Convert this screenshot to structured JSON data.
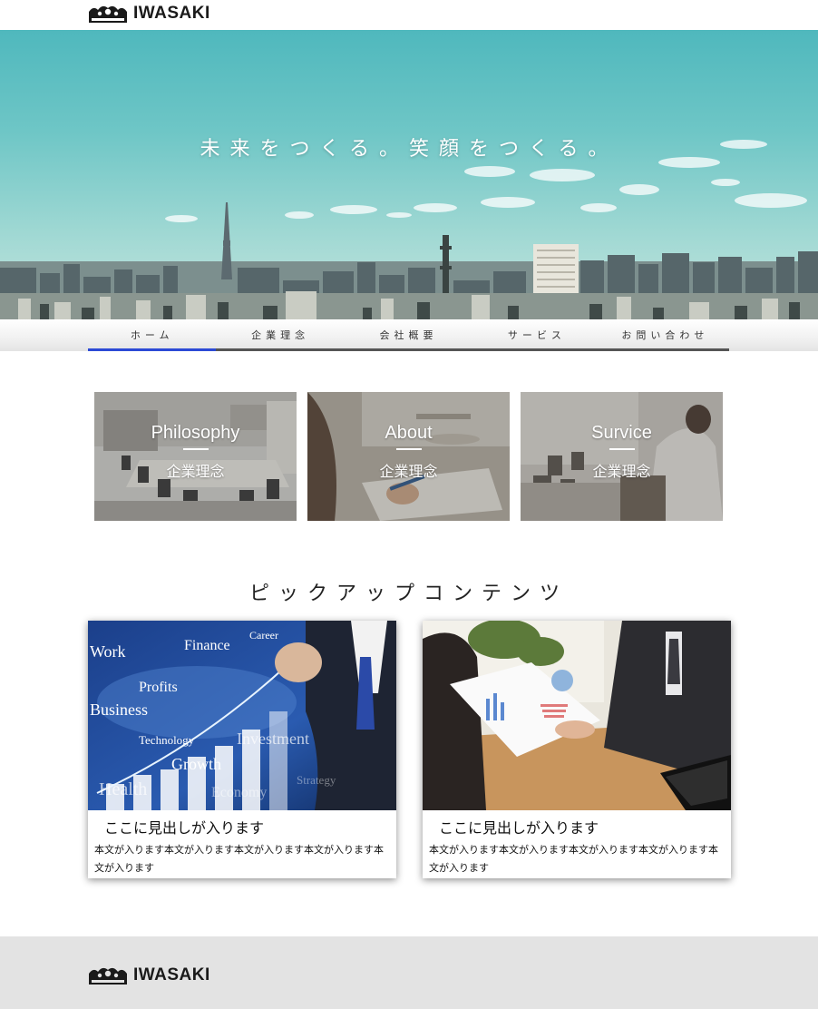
{
  "header": {
    "logo_text": "IWASAKI",
    "logo_icon": "iwasaki-logo-mark"
  },
  "hero": {
    "tagline": "未来をつくる。笑顔をつくる。"
  },
  "nav": {
    "items": [
      {
        "label": "ホーム",
        "active": true
      },
      {
        "label": "企業理念",
        "active": false
      },
      {
        "label": "会社概要",
        "active": false
      },
      {
        "label": "サービス",
        "active": false
      },
      {
        "label": "お問い合わせ",
        "active": false
      }
    ],
    "active_color": "#2c4ad6"
  },
  "tiles": [
    {
      "title_en": "Philosophy",
      "title_ja": "企業理念"
    },
    {
      "title_en": "About",
      "title_ja": "企業理念"
    },
    {
      "title_en": "Survice",
      "title_ja": "企業理念"
    }
  ],
  "pickup": {
    "heading": "ピックアップコンテンツ",
    "cards": [
      {
        "title": "ここに見出しが入ります",
        "body": "本文が入ります本文が入ります本文が入ります本文が入ります本文が入ります",
        "image_words": [
          "Work",
          "Finance",
          "Career",
          "Profits",
          "Business",
          "Technology",
          "Growth",
          "Investment",
          "Health",
          "Economy",
          "Strategy"
        ]
      },
      {
        "title": "ここに見出しが入ります",
        "body": "本文が入ります本文が入ります本文が入ります本文が入ります本文が入ります"
      }
    ]
  },
  "footer": {
    "logo_text": "IWASAKI"
  }
}
